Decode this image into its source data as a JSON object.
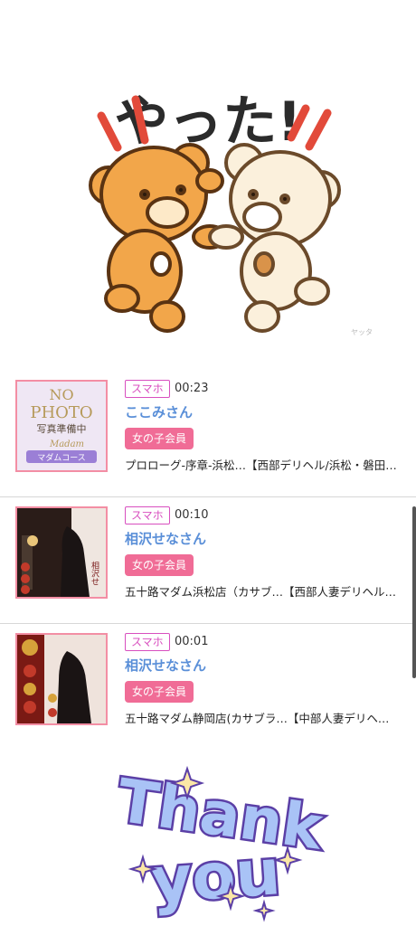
{
  "top_sticker": {
    "text": "やった!",
    "watermark": "ヤッタ"
  },
  "visits": [
    {
      "device": "スマホ",
      "time": "00:23",
      "name": "ここみさん",
      "member": "女の子会員",
      "shop": "プロローグ-序章-浜松…【西部デリヘル/浜松・磐田…",
      "thumb_text": {
        "l1": "NO",
        "l2": "PHOTO",
        "l3": "写真準備中",
        "l4": "Madam",
        "l5": "マダムコース"
      }
    },
    {
      "device": "スマホ",
      "time": "00:10",
      "name": "相沢せなさん",
      "member": "女の子会員",
      "shop": "五十路マダム浜松店（カサブ…【西部人妻デリヘル…",
      "thumb_text": {
        "side": "相沢せ"
      }
    },
    {
      "device": "スマホ",
      "time": "00:01",
      "name": "相沢せなさん",
      "member": "女の子会員",
      "shop": "五十路マダム静岡店(カサブラ…【中部人妻デリヘ…",
      "thumb_text": {}
    }
  ],
  "bottom_sticker": {
    "line1": "Thank",
    "line2": "you"
  },
  "colors": {
    "device_border": "#d84fbf",
    "name": "#5a8fd8",
    "member_bg": "#f06c96",
    "thumb_border": "#f38ea4",
    "thank_fill": "#a9c3f6",
    "thank_stroke": "#5b3fa6"
  }
}
